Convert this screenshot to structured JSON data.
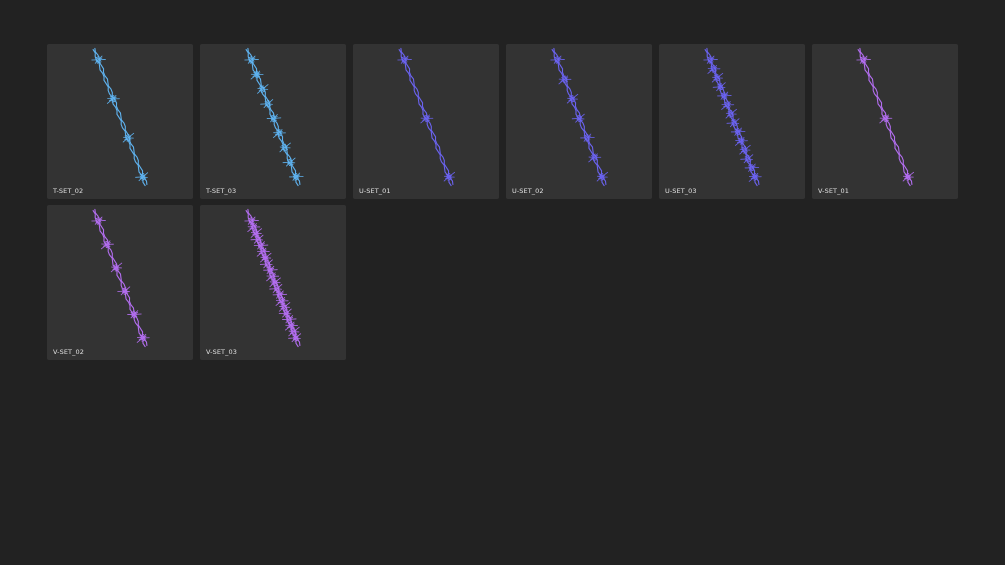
{
  "items": [
    {
      "label": "T-SET_02",
      "color": "#5fb3f0",
      "barb_count": 4,
      "icon": "barbed-wire-icon"
    },
    {
      "label": "T-SET_03",
      "color": "#5fb3f0",
      "barb_count": 9,
      "icon": "barbed-wire-icon"
    },
    {
      "label": "U-SET_01",
      "color": "#6b63f0",
      "barb_count": 3,
      "icon": "barbed-wire-icon"
    },
    {
      "label": "U-SET_02",
      "color": "#6b63f0",
      "barb_count": 7,
      "icon": "barbed-wire-icon"
    },
    {
      "label": "U-SET_03",
      "color": "#6b63f0",
      "barb_count": 14,
      "icon": "barbed-wire-icon"
    },
    {
      "label": "V-SET_01",
      "color": "#b36ef0",
      "barb_count": 3,
      "icon": "barbed-wire-icon"
    },
    {
      "label": "V-SET_02",
      "color": "#b36ef0",
      "barb_count": 6,
      "icon": "barbed-wire-icon"
    },
    {
      "label": "V-SET_03",
      "color": "#b36ef0",
      "barb_count": 20,
      "icon": "barbed-wire-icon"
    }
  ]
}
